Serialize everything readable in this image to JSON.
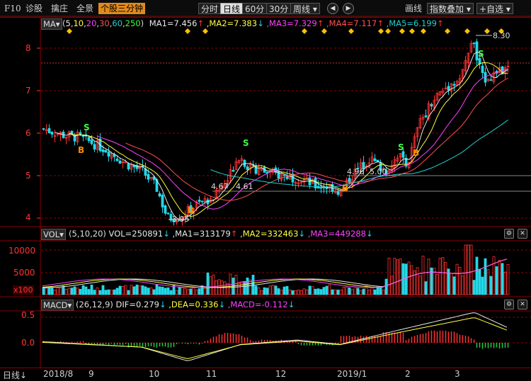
{
  "toolbar": {
    "f10": "F10",
    "items": [
      "诊股",
      "擒庄",
      "全景"
    ],
    "highlight": "个股三分钟",
    "periods": [
      "分时",
      "日线",
      "60分",
      "30分",
      "周线 ▾"
    ],
    "selected_period": "日线",
    "right": [
      "画线",
      "指数叠加 ▾",
      "+自选 ▾"
    ]
  },
  "price_panel": {
    "indicator_btn": "MA▾",
    "params_prefix": "(",
    "params": [
      "5",
      "10",
      "20",
      "30",
      "60",
      "250"
    ],
    "params_suffix": ")",
    "ma": [
      {
        "label": "MA1=7.456",
        "arrow": "↑",
        "color": "#e8e8e8"
      },
      {
        "label": ",MA2=7.383",
        "arrow": "↓",
        "color": "#ffff40"
      },
      {
        "label": ",MA3=7.329",
        "arrow": "↑",
        "color": "#ff40ff"
      },
      {
        "label": ",MA4=7.117",
        "arrow": "↑",
        "color": "#ff5050"
      },
      {
        "label": ",MA5=6.199",
        "arrow": "↑",
        "color": "#20d0d0"
      }
    ],
    "y_ticks": [
      "8",
      "7",
      "6",
      "5",
      "4"
    ],
    "annotations": {
      "high": "8.30",
      "low": "3.95",
      "t1": "4.67",
      "t2": "4.61",
      "t3": "4.96",
      "t4": "5.00"
    },
    "buy_mark": "B",
    "sell_mark": "S"
  },
  "volume_panel": {
    "indicator_btn": "VOL▾",
    "params": "(5,10,20)",
    "vol": "VOL=250891",
    "ma": [
      {
        "label": ",MA1=313179",
        "arrow": "↑",
        "color": "#e8e8e8"
      },
      {
        "label": ",MA2=332463",
        "arrow": "↓",
        "color": "#ffff40"
      },
      {
        "label": ",MA3=449288",
        "arrow": "↓",
        "color": "#ff40ff"
      }
    ],
    "y_ticks": [
      "10000",
      "5000"
    ],
    "unit": "x100"
  },
  "macd_panel": {
    "indicator_btn": "MACD▾",
    "params": "(26,12,9)",
    "dif": "DIF=0.279",
    "dif_arrow": "↓",
    "dea": ",DEA=0.336",
    "dea_arrow": "↓",
    "macd": ",MACD=-0.112",
    "macd_arrow": "↓",
    "y_ticks": [
      "0.5",
      "0.0"
    ]
  },
  "x_axis": {
    "mode": "日线",
    "mode_arrow": "↓",
    "labels": [
      "2018/8",
      "9",
      "10",
      "11",
      "12",
      "2019/1",
      "2",
      "3"
    ]
  },
  "colors": {
    "up": "#ff3333",
    "down": "#22d8e8",
    "grid": "#8b0000",
    "bg": "#000000"
  }
}
